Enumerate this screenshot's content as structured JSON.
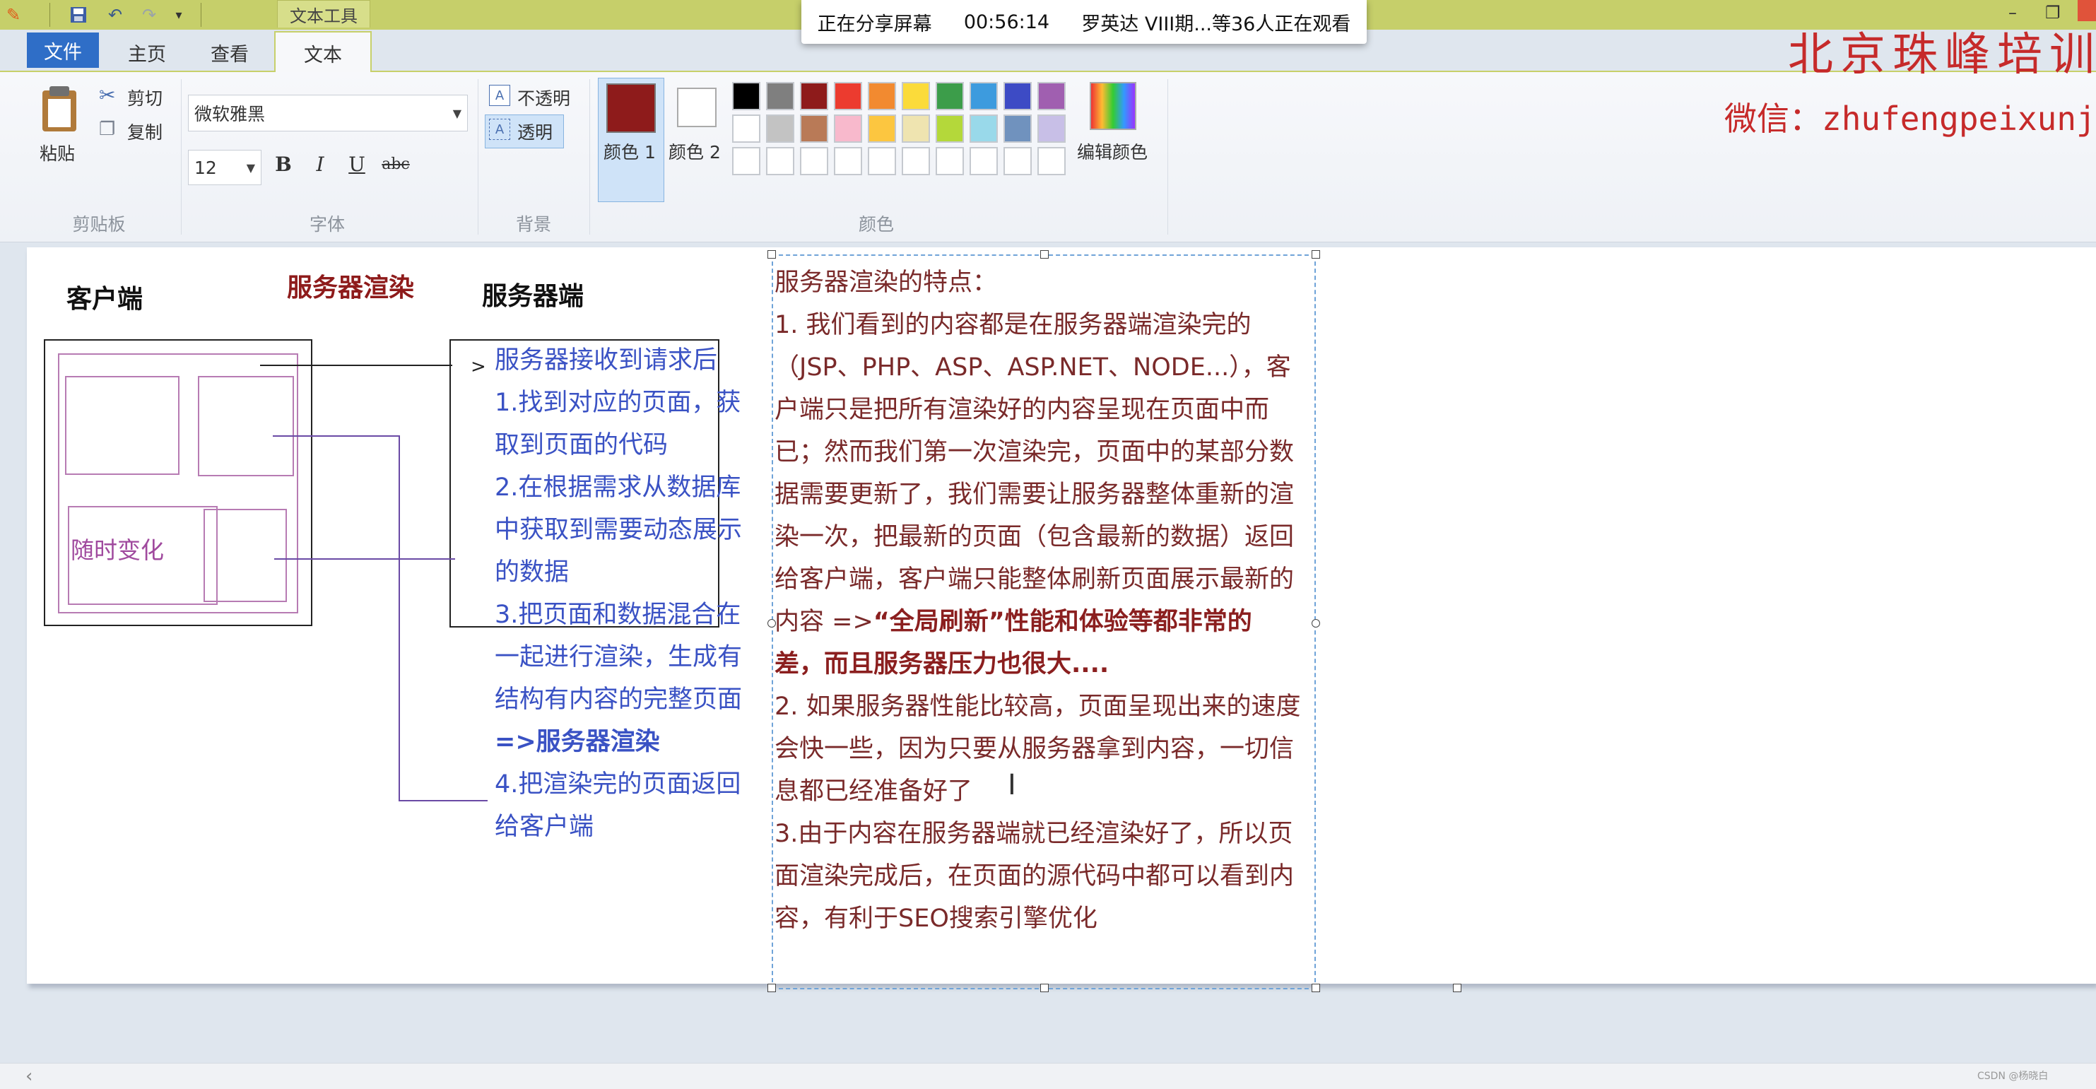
{
  "title_bar": {
    "context_tab": "文本工具",
    "quick_access": [
      "paint-app-icon",
      "save-icon",
      "undo-icon",
      "redo-icon",
      "customize-icon"
    ]
  },
  "share_overlay": {
    "status": "正在分享屏幕",
    "timer": "00:56:14",
    "viewers": "罗英达 VIII期...等36人正在观看"
  },
  "watermark": {
    "school": "北京珠峰培训",
    "wechat": "微信：zhufengpeixunjiu"
  },
  "tabs": [
    {
      "label": "文件"
    },
    {
      "label": "主页"
    },
    {
      "label": "查看"
    },
    {
      "label": "文本"
    }
  ],
  "ribbon": {
    "clipboard": {
      "paste": "粘贴",
      "cut": "剪切",
      "copy": "复制",
      "group": "剪贴板"
    },
    "font": {
      "family": "微软雅黑",
      "size": "12",
      "bold": "B",
      "italic": "I",
      "underline": "U",
      "strike": "abc",
      "group": "字体"
    },
    "background": {
      "opaque": "不透明",
      "transparent": "透明",
      "group": "背景"
    },
    "colors": {
      "color1": "颜色 1",
      "color2": "颜色 2",
      "edit": "编辑颜色",
      "group": "颜色",
      "color1_value": "#8e1b1b",
      "color2_value": "#ffffff",
      "palette_row1": [
        "#000000",
        "#7f7f7f",
        "#8e1b1b",
        "#ec3b2f",
        "#f28a30",
        "#fbdb3a",
        "#3c9d4a",
        "#3d9bde",
        "#3d4bc5",
        "#a05fb0"
      ],
      "palette_row2": [
        "#ffffff",
        "#c3c3c3",
        "#b97a57",
        "#f8b9cc",
        "#fcc640",
        "#efe4b0",
        "#b4d83a",
        "#99d9ea",
        "#7092be",
        "#c8bfe7"
      ],
      "palette_row3": [
        "#ffffff",
        "#ffffff",
        "#ffffff",
        "#ffffff",
        "#ffffff",
        "#ffffff",
        "#ffffff",
        "#ffffff",
        "#ffffff",
        "#ffffff"
      ]
    }
  },
  "diagram": {
    "client": "客户端",
    "ssr": "服务器渲染",
    "server": "服务器端",
    "changing": "随时变化",
    "steps": [
      "服务器接收到请求后",
      "1.找到对应的页面，获",
      "取到页面的代码",
      "2.在根据需求从数据库",
      "中获取到需要动态展示",
      "的数据",
      "3.把页面和数据混合在",
      "一起进行渲染，生成有",
      "结构有内容的完整页面",
      "=>服务器渲染",
      "4.把渲染完的页面返回",
      "给客户端"
    ]
  },
  "features": {
    "heading": "服务器渲染的特点：",
    "lines": [
      "1. 我们看到的内容都是在服务器端渲染完的",
      "（JSP、PHP、ASP、ASP.NET、NODE...），客",
      "户端只是把所有渲染好的内容呈现在页面中而",
      "已；然而我们第一次渲染完，页面中的某部分数",
      "据需要更新了，我们需要让服务器整体重新的渲",
      "染一次，把最新的页面（包含最新的数据）返回",
      "给客户端，客户端只能整体刷新页面展示最新的"
    ],
    "line8_prefix": "内容 =>",
    "line8_bold": "“全局刷新”性能和体验等都非常的",
    "line9_bold": "差，而且服务器压力也很大....",
    "lines2": [
      "2. 如果服务器性能比较高，页面呈现出来的速度",
      "会快一些，因为只要从服务器拿到内容，一切信",
      "息都已经准备好了",
      "3.由于内容在服务器端就已经渲染好了，所以页",
      "面渲染完成后，在页面的源代码中都可以看到内",
      "容，有利于SEO搜索引擎优化"
    ]
  },
  "footer": {
    "credit": "CSDN @杨晓白"
  }
}
